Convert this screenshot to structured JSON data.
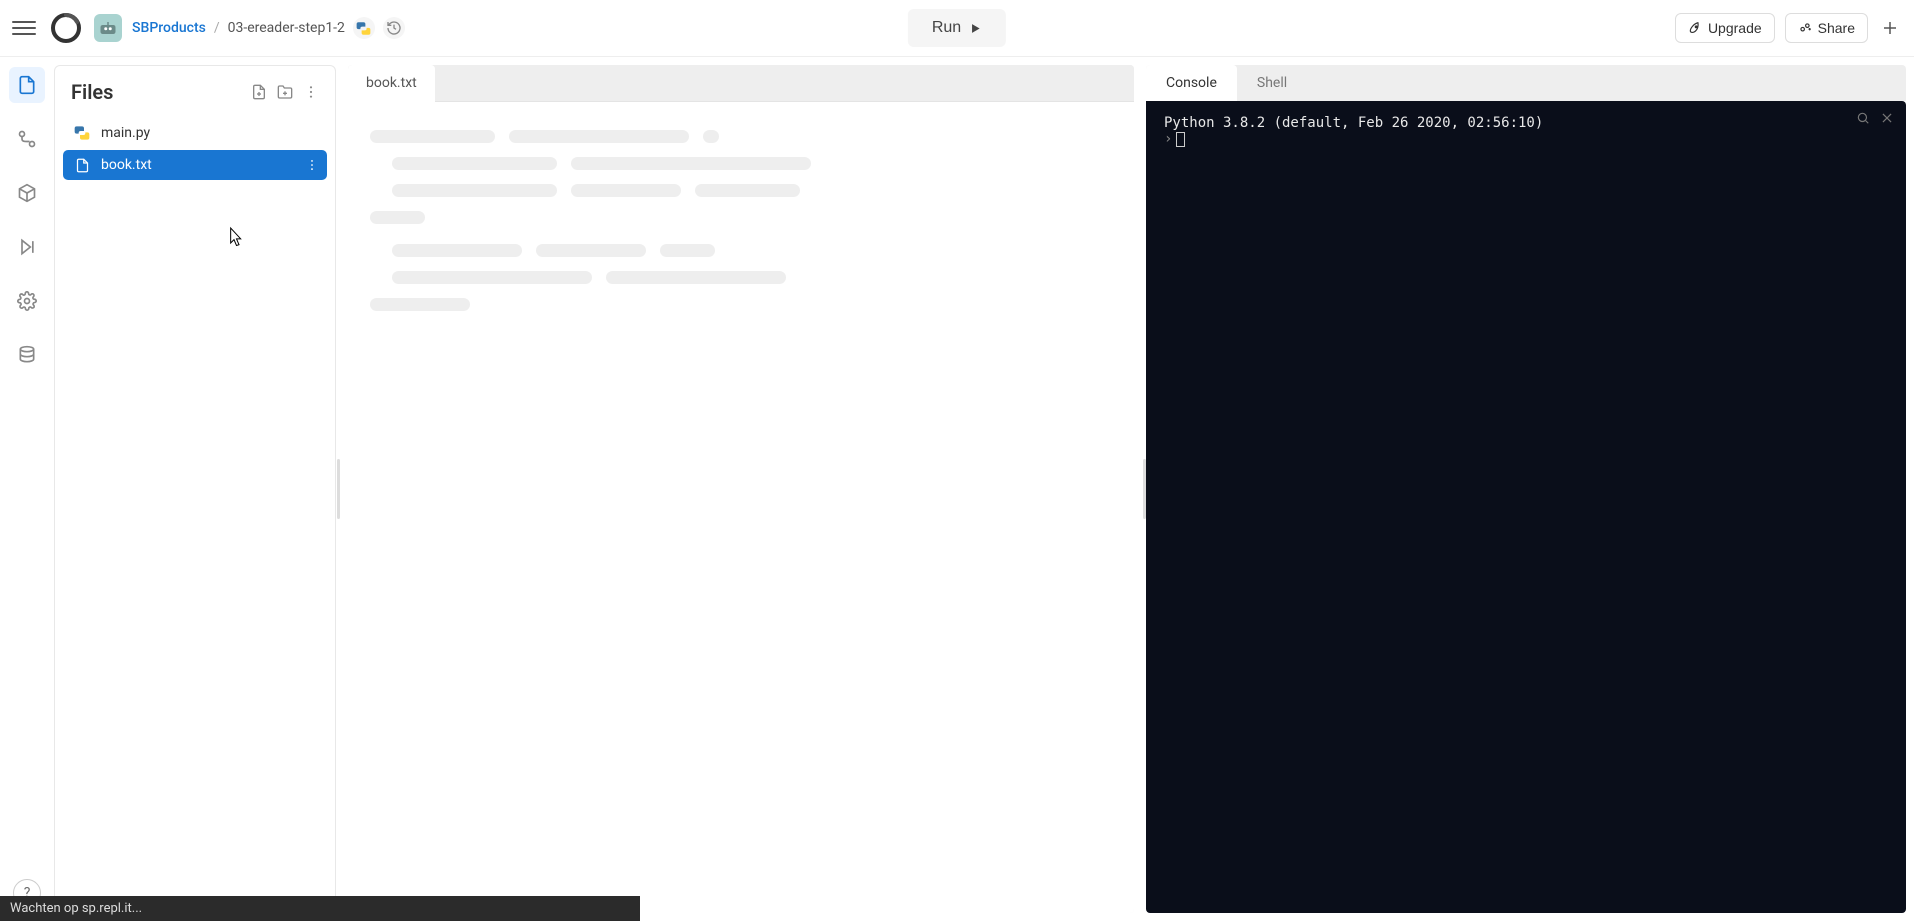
{
  "header": {
    "owner": "SBProducts",
    "project": "03-ereader-step1-2",
    "run_label": "Run",
    "upgrade_label": "Upgrade",
    "share_label": "Share"
  },
  "files_panel": {
    "title": "Files",
    "items": [
      {
        "name": "main.py",
        "icon": "python",
        "selected": false
      },
      {
        "name": "book.txt",
        "icon": "file",
        "selected": true
      }
    ]
  },
  "editor": {
    "tabs": [
      {
        "label": "book.txt",
        "active": true
      }
    ]
  },
  "console": {
    "tabs": [
      {
        "label": "Console",
        "active": true
      },
      {
        "label": "Shell",
        "active": false
      }
    ],
    "line1": "Python 3.8.2 (default, Feb 26 2020, 02:56:10)",
    "prompt": ""
  },
  "status_bar": "Wachten op sp.repl.it...",
  "rail_help": "?"
}
